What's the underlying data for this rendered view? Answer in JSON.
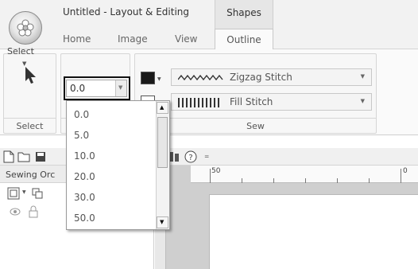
{
  "window": {
    "title": "Untitled - Layout & Editing",
    "context_tab": "Shapes"
  },
  "tabs": [
    {
      "label": "Home"
    },
    {
      "label": "Image"
    },
    {
      "label": "View"
    },
    {
      "label": "Outline"
    }
  ],
  "ribbon": {
    "select_group": {
      "button_label": "Select",
      "group_label": "Select"
    },
    "sew_group": {
      "group_label": "Sew",
      "outline_stitch": "Zigzag Stitch",
      "fill_stitch": "Fill Stitch"
    }
  },
  "stitch_width_combo": {
    "value": "0.0",
    "options": [
      "0.0",
      "5.0",
      "10.0",
      "20.0",
      "30.0",
      "50.0"
    ]
  },
  "sewing_order_pane": {
    "title": "Sewing Orc"
  },
  "ruler": {
    "labels": [
      "50",
      "0"
    ]
  },
  "colors": {
    "accent_outline": "#111111",
    "swatch": "#1a1a1a"
  },
  "icons": {
    "app": "flower-orb-icon",
    "select": "arrow-cursor-icon",
    "new": "new-file-icon",
    "open": "open-folder-icon",
    "save": "save-icon",
    "help": "help-icon"
  }
}
